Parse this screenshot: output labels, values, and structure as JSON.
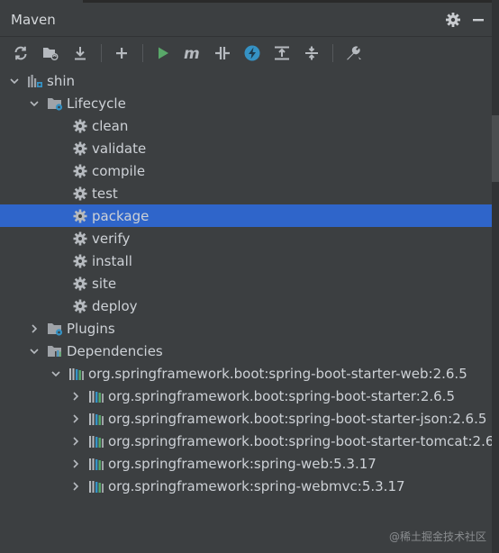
{
  "panel": {
    "title": "Maven"
  },
  "toolbar": {
    "buttons": [
      "reload-icon",
      "add-project-icon",
      "download-icon",
      "plus-icon",
      "run-icon",
      "execute-goal-icon",
      "toggle-offline-icon",
      "skip-tests-icon",
      "show-dependencies-icon",
      "collapse-all-icon",
      "settings-wrench-icon"
    ]
  },
  "tree": {
    "project": "shin",
    "lifecycle": {
      "label": "Lifecycle",
      "goals": [
        "clean",
        "validate",
        "compile",
        "test",
        "package",
        "verify",
        "install",
        "site",
        "deploy"
      ],
      "selected": "package"
    },
    "plugins": "Plugins",
    "dependencies": {
      "label": "Dependencies",
      "root": "org.springframework.boot:spring-boot-starter-web:2.6.5",
      "children": [
        "org.springframework.boot:spring-boot-starter:2.6.5",
        "org.springframework.boot:spring-boot-starter-json:2.6.5",
        "org.springframework.boot:spring-boot-starter-tomcat:2.6",
        "org.springframework:spring-web:5.3.17",
        "org.springframework:spring-webmvc:5.3.17"
      ]
    }
  },
  "colors": {
    "background": "#3c3f41",
    "selection": "#2f65ca",
    "run_green": "#59a869",
    "icon_gray": "#b6babf"
  },
  "watermark": "@稀土掘金技术社区"
}
